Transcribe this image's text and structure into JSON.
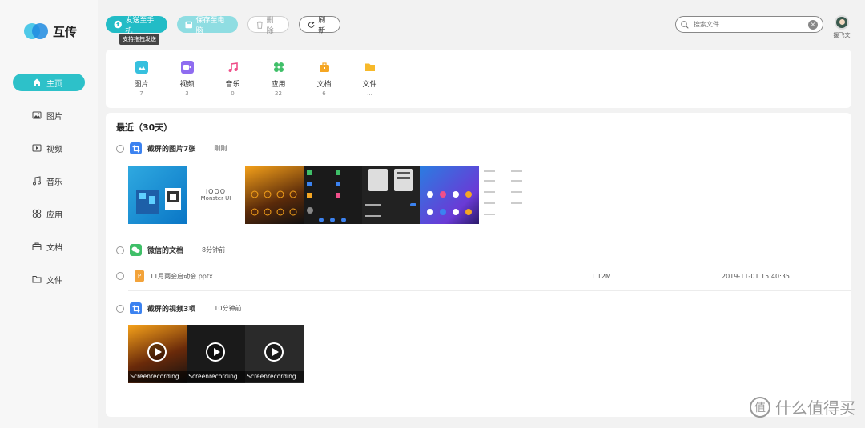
{
  "app": {
    "name": "互传"
  },
  "sidebar": {
    "items": [
      {
        "label": "主页",
        "icon": "home-icon"
      },
      {
        "label": "图片",
        "icon": "image-icon"
      },
      {
        "label": "视频",
        "icon": "video-icon"
      },
      {
        "label": "音乐",
        "icon": "music-icon"
      },
      {
        "label": "应用",
        "icon": "apps-icon"
      },
      {
        "label": "文档",
        "icon": "briefcase-icon"
      },
      {
        "label": "文件",
        "icon": "folder-icon"
      }
    ]
  },
  "toolbar": {
    "send_label": "发送至手机",
    "send_tooltip": "支持拖拽发送",
    "save_label": "保存至电脑",
    "delete_label": "删除",
    "refresh_label": "刷新"
  },
  "search": {
    "placeholder": "搜索文件"
  },
  "user": {
    "name": "援飞文"
  },
  "categories": [
    {
      "name": "图片",
      "count": "7",
      "color": "#36c0de"
    },
    {
      "name": "视频",
      "count": "3",
      "color": "#8f6cf0"
    },
    {
      "name": "音乐",
      "count": "0",
      "color": "#f04f8a"
    },
    {
      "name": "应用",
      "count": "22",
      "color": "#3fbf68"
    },
    {
      "name": "文档",
      "count": "6",
      "color": "#f5a623"
    },
    {
      "name": "文件",
      "count": "...",
      "color": "#f7b92a"
    }
  ],
  "recent": {
    "title": "最近（30天）",
    "groups": [
      {
        "name": "截屏的图片7张",
        "time": "刚刚"
      },
      {
        "name": "微信的文档",
        "time": "8分钟前"
      },
      {
        "name": "截屏的视频3项",
        "time": "10分钟前"
      }
    ],
    "file": {
      "name": "11月两会启动会.pptx",
      "size": "1.12M",
      "date": "2019-11-01 15:40:35",
      "type_badge": "P"
    },
    "videos": [
      {
        "name": "Screenrecording..."
      },
      {
        "name": "Screenrecording..."
      },
      {
        "name": "Screenrecording..."
      }
    ],
    "thumb_text": {
      "brand": "iQOO",
      "sub": "Monster UI"
    }
  },
  "watermark": {
    "text": "什么值得买",
    "logo": "值"
  },
  "colors": {
    "accent": "#22bcc6",
    "accent_light": "#8fdde2"
  }
}
